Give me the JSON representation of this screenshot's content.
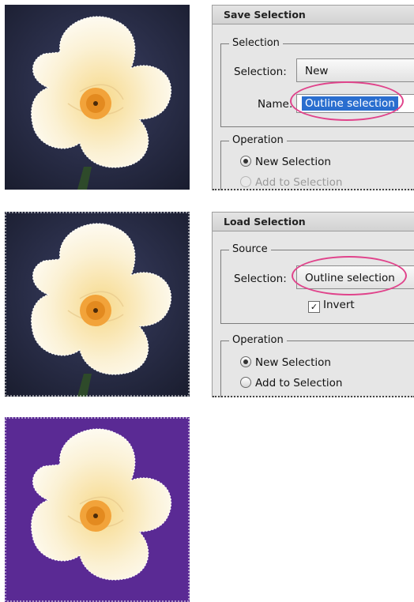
{
  "save_dialog": {
    "title": "Save Selection",
    "group_selection": "Selection",
    "selection_label": "Selection:",
    "selection_value": "New",
    "name_label": "Name:",
    "name_value": "Outline selection",
    "group_operation": "Operation",
    "op_new": "New Selection",
    "op_add": "Add to Selection"
  },
  "load_dialog": {
    "title": "Load Selection",
    "group_source": "Source",
    "selection_label": "Selection:",
    "selection_value": "Outline selection",
    "invert_label": "Invert",
    "invert_checked": true,
    "group_operation": "Operation",
    "op_new": "New Selection",
    "op_add": "Add to Selection"
  },
  "colors": {
    "highlight_circle": "#e0438b",
    "purple_background": "#5a2a94",
    "text_selection": "#2a6ecf"
  }
}
